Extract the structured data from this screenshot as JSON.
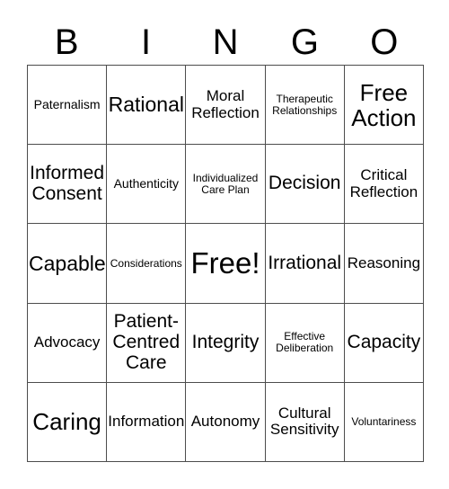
{
  "card": {
    "title": "BINGO",
    "header_letters": [
      "B",
      "I",
      "N",
      "G",
      "O"
    ],
    "grid_color": "#4d4d4d",
    "text_color": "#000000",
    "background_color": "#ffffff",
    "rows": 5,
    "columns": 5,
    "free_space": {
      "row": 2,
      "column": 2,
      "label": "Free!"
    },
    "cells": [
      [
        {
          "label": "Paternalism",
          "size": "fs-sm"
        },
        {
          "label": "Rational",
          "size": "fs-xl"
        },
        {
          "label": "Moral Reflection",
          "size": "fs-md"
        },
        {
          "label": "Therapeutic Relationships",
          "size": "fs-xs"
        },
        {
          "label": "Free Action",
          "size": "fs-xxl"
        }
      ],
      [
        {
          "label": "Informed Consent",
          "size": "fs-lg"
        },
        {
          "label": "Authenticity",
          "size": "fs-sm"
        },
        {
          "label": "Individualized Care Plan",
          "size": "fs-xs"
        },
        {
          "label": "Decision",
          "size": "fs-lg"
        },
        {
          "label": "Critical Reflection",
          "size": "fs-md"
        }
      ],
      [
        {
          "label": "Capable",
          "size": "fs-xl"
        },
        {
          "label": "Considerations",
          "size": "fs-xs"
        },
        {
          "label": "Free!",
          "size": "fs-free"
        },
        {
          "label": "Irrational",
          "size": "fs-lg"
        },
        {
          "label": "Reasoning",
          "size": "fs-md"
        }
      ],
      [
        {
          "label": "Advocacy",
          "size": "fs-md"
        },
        {
          "label": "Patient-Centred Care",
          "size": "fs-lg"
        },
        {
          "label": "Integrity",
          "size": "fs-lg"
        },
        {
          "label": "Effective Deliberation",
          "size": "fs-xs"
        },
        {
          "label": "Capacity",
          "size": "fs-lg"
        }
      ],
      [
        {
          "label": "Caring",
          "size": "fs-xxl"
        },
        {
          "label": "Information",
          "size": "fs-md"
        },
        {
          "label": "Autonomy",
          "size": "fs-md"
        },
        {
          "label": "Cultural Sensitivity",
          "size": "fs-md"
        },
        {
          "label": "Voluntariness",
          "size": "fs-xs"
        }
      ]
    ]
  }
}
